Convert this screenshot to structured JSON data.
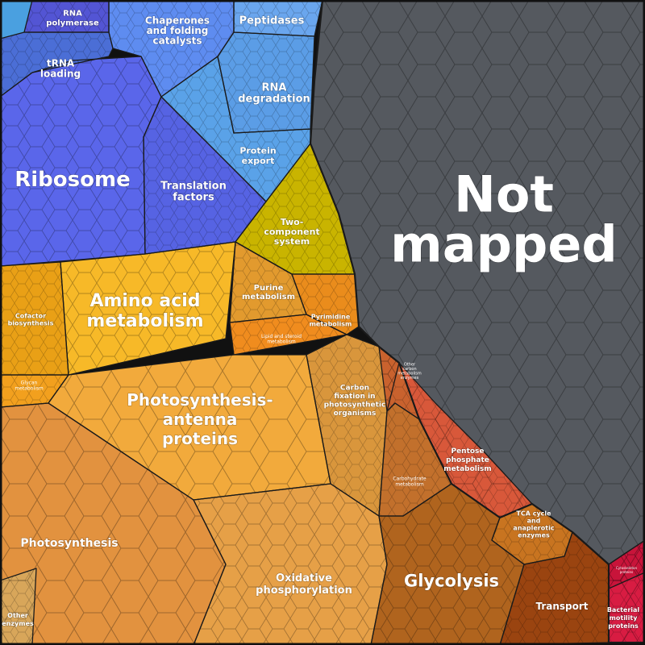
{
  "regions": [
    {
      "id": "not-mapped",
      "label": [
        "Not",
        "mapped"
      ],
      "color": "#55595f"
    },
    {
      "id": "ribosome",
      "label": [
        "Ribosome"
      ],
      "color": "#5a66ea"
    },
    {
      "id": "translation-factors",
      "label": [
        "Translation",
        "factors"
      ],
      "color": "#5663e3"
    },
    {
      "id": "trna-loading",
      "label": [
        "tRNA",
        "loading"
      ],
      "color": "#4b6ed6"
    },
    {
      "id": "rna-polymerase",
      "label": [
        "RNA",
        "polymerase"
      ],
      "color": "#5355d4"
    },
    {
      "id": "chaperones",
      "label": [
        "Chaperones",
        "and folding",
        "catalysts"
      ],
      "color": "#5e8cf0"
    },
    {
      "id": "peptidases",
      "label": [
        "Peptidases"
      ],
      "color": "#6aa6ee"
    },
    {
      "id": "rna-degradation",
      "label": [
        "RNA",
        "degradation"
      ],
      "color": "#5b9de6"
    },
    {
      "id": "protein-export",
      "label": [
        "Protein",
        "export"
      ],
      "color": "#5aa2e8"
    },
    {
      "id": "two-component",
      "label": [
        "Two-",
        "component",
        "system"
      ],
      "color": "#c9b400"
    },
    {
      "id": "amino-acid",
      "label": [
        "Amino acid",
        "metabolism"
      ],
      "color": "#f7b928"
    },
    {
      "id": "cofactor",
      "label": [
        "Cofactor",
        "biosynthesis"
      ],
      "color": "#e9a016"
    },
    {
      "id": "purine",
      "label": [
        "Purine",
        "metabolism"
      ],
      "color": "#e29a2e"
    },
    {
      "id": "pyrimidine",
      "label": [
        "Pyrimidine",
        "metabolism"
      ],
      "color": "#ea8c1c"
    },
    {
      "id": "lipid-steroid",
      "label": [
        "Lipid and steroid",
        "metabolism"
      ],
      "color": "#f08c1e"
    },
    {
      "id": "glycan",
      "label": [
        "Glycan",
        "metabolism"
      ],
      "color": "#f2a01e"
    },
    {
      "id": "photosynthesis-antenna",
      "label": [
        "Photosynthesis-",
        "antenna",
        "proteins"
      ],
      "color": "#f2aa3c"
    },
    {
      "id": "carbon-fixation",
      "label": [
        "Carbon",
        "fixation in",
        "photosynthetic",
        "organisms"
      ],
      "color": "#d9963c"
    },
    {
      "id": "photosynthesis",
      "label": [
        "Photosynthesis"
      ],
      "color": "#e2923f"
    },
    {
      "id": "oxidative-phosphorylation",
      "label": [
        "Oxidative",
        "phosphorylation"
      ],
      "color": "#e6a047"
    },
    {
      "id": "other-enzymes",
      "label": [
        "Other",
        "enzymes"
      ],
      "color": "#d8a65a"
    },
    {
      "id": "other-carbon",
      "label": [
        "Other",
        "carbon",
        "metabolism",
        "enzymes"
      ],
      "color": "#c9622e"
    },
    {
      "id": "pentose-phosphate",
      "label": [
        "Pentose",
        "phosphate",
        "metabolism"
      ],
      "color": "#d8583a"
    },
    {
      "id": "carbohydrate",
      "label": [
        "Carbohydrate",
        "metabolism"
      ],
      "color": "#c2702c"
    },
    {
      "id": "tca-cycle",
      "label": [
        "TCA cycle",
        "and",
        "anaplerotic",
        "enzymes"
      ],
      "color": "#c87420"
    },
    {
      "id": "glycolysis",
      "label": [
        "Glycolysis"
      ],
      "color": "#b0641e"
    },
    {
      "id": "transport",
      "label": [
        "Transport"
      ],
      "color": "#9a4410"
    },
    {
      "id": "bacterial-motility",
      "label": [
        "Bacterial",
        "motility",
        "proteins"
      ],
      "color": "#d81c42"
    },
    {
      "id": "cytoskeleton",
      "label": [
        "Cytoskeleton",
        "proteins"
      ],
      "color": "#c8143a"
    }
  ]
}
